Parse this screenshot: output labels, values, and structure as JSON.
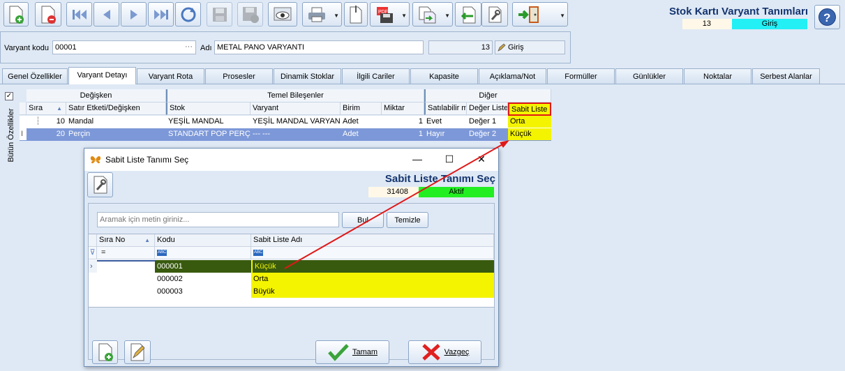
{
  "window": {
    "title": "Stok Kartı Varyant Tanımları",
    "record_no": "13",
    "mode": "Giriş"
  },
  "form": {
    "variant_code_label": "Varyant kodu",
    "variant_code_value": "00001",
    "ellipsis": "···",
    "name_label": "Adı",
    "name_value": "METAL PANO VARYANTI",
    "count": "13",
    "entry_button": "Giriş"
  },
  "tabs": [
    "Genel Özellikler",
    "Varyant Detayı",
    "Varyant Rota",
    "Prosesler",
    "Dinamik Stoklar",
    "İlgili Cariler",
    "Kapasite",
    "Açıklama/Not",
    "Formüller",
    "Günlükler",
    "Noktalar",
    "Serbest Alanlar"
  ],
  "side_label": "Bütün Özellikler",
  "grid": {
    "bands": [
      "Değişken",
      "Temel Bileşenler",
      "Diğer"
    ],
    "columns": [
      "Sıra",
      "Satır Etketi/Değişken",
      "Stok",
      "Varyant",
      "Birim",
      "Miktar",
      "Satılabilir mi",
      "Değer Liste",
      "Sabit Liste"
    ],
    "rows": [
      [
        "10",
        "Mandal",
        "YEŞİL MANDAL",
        "YEŞİL MANDAL VARYANTI",
        "Adet",
        "1",
        "Evet",
        "Değer 1",
        "Orta"
      ],
      [
        "20",
        "Perçin",
        "STANDART POP PERÇİN",
        "--- ---",
        "Adet",
        "1",
        "Hayır",
        "Değer 2",
        "Küçük"
      ]
    ]
  },
  "dialog": {
    "title": "Sabit Liste Tanımı Seç",
    "header": "Sabit Liste Tanımı Seç",
    "record_no": "31408",
    "status": "Aktif",
    "search_placeholder": "Aramak için metin giriniz...",
    "find_button": "Bul",
    "clear_button": "Temizle",
    "columns": [
      "Sıra No",
      "Kodu",
      "Sabit Liste Adı"
    ],
    "filter_eq": "=",
    "filter_abc": "ABC",
    "rows": [
      [
        "",
        "000001",
        "Küçük"
      ],
      [
        "",
        "000002",
        "Orta"
      ],
      [
        "",
        "000003",
        "Büyük"
      ]
    ],
    "ok_button": "Tamam",
    "cancel_button": "Vazgeç"
  },
  "colors": {
    "highlight_yellow": "#f4f400",
    "selected_row": "#7d98d8",
    "dialog_selected_row": "#385a0e",
    "status_green": "#22ee22",
    "status_cyan": "#22f0f5",
    "arrow_red": "#e01818"
  }
}
